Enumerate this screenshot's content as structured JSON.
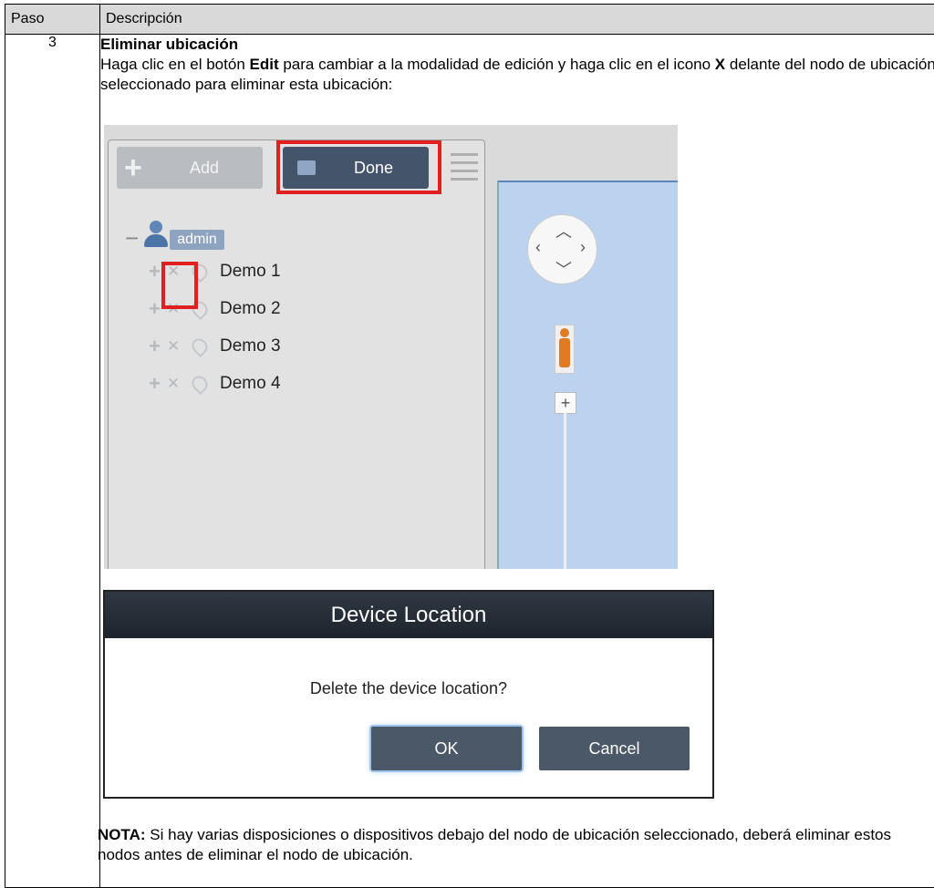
{
  "table": {
    "headers": {
      "paso": "Paso",
      "descripcion": "Descripción"
    },
    "step": {
      "number": "3",
      "title": "Eliminar ubicación",
      "instr_part1": "Haga clic en el botón ",
      "instr_bold1": "Edit",
      "instr_part2": " para cambiar a la modalidad de edición y haga clic en el icono ",
      "instr_bold2": "X",
      "instr_part3": " delante del nodo de ubicación seleccionado para eliminar esta ubicación:"
    },
    "note": {
      "label": "NOTA:",
      "text": " Si hay varias disposiciones o dispositivos debajo del nodo de ubicación seleccionado, deberá eliminar estos nodos antes de eliminar el nodo de ubicación."
    }
  },
  "screenshot1": {
    "add_label": "Add",
    "done_label": "Done",
    "root_user": "admin",
    "nodes": [
      "Demo 1",
      "Demo 2",
      "Demo 3",
      "Demo 4"
    ]
  },
  "dialog": {
    "title": "Device Location",
    "message": "Delete the device location?",
    "ok_label": "OK",
    "cancel_label": "Cancel"
  },
  "colors": {
    "highlight": "#e02020",
    "dialog_button": "#4b5868",
    "map": "#bcd3f0"
  }
}
